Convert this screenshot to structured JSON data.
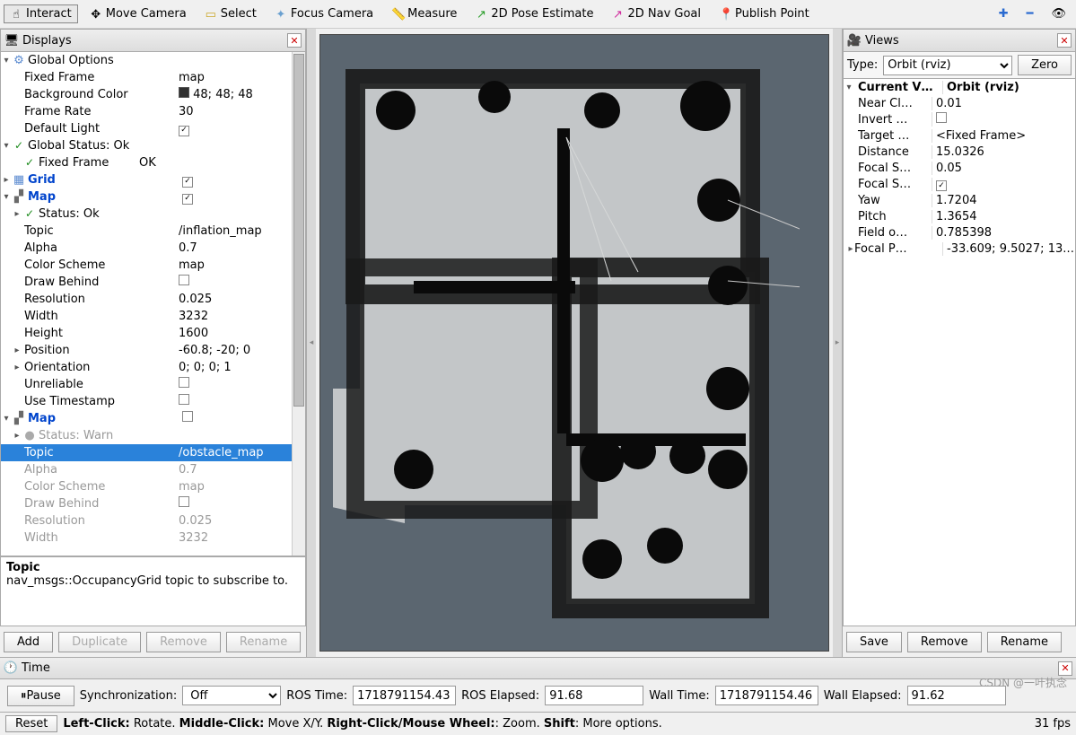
{
  "toolbar": {
    "interact": "Interact",
    "move_camera": "Move Camera",
    "select": "Select",
    "focus_camera": "Focus Camera",
    "measure": "Measure",
    "pose_2d": "2D Pose Estimate",
    "nav_2d": "2D Nav Goal",
    "publish_point": "Publish Point"
  },
  "displays": {
    "title": "Displays",
    "global_options": "Global Options",
    "fixed_frame_lbl": "Fixed Frame",
    "fixed_frame_val": "map",
    "bgcolor_lbl": "Background Color",
    "bgcolor_val": "48; 48; 48",
    "frame_rate_lbl": "Frame Rate",
    "frame_rate_val": "30",
    "default_light_lbl": "Default Light",
    "global_status": "Global Status: Ok",
    "fixed_frame2_lbl": "Fixed Frame",
    "fixed_frame2_val": "OK",
    "grid": "Grid",
    "map1": "Map",
    "status_ok": "Status: Ok",
    "topic_lbl": "Topic",
    "topic1_val": "/inflation_map",
    "alpha_lbl": "Alpha",
    "alpha_val": "0.7",
    "color_scheme_lbl": "Color Scheme",
    "color_scheme_val": "map",
    "draw_behind_lbl": "Draw Behind",
    "resolution_lbl": "Resolution",
    "resolution_val": "0.025",
    "width_lbl": "Width",
    "width_val": "3232",
    "height_lbl": "Height",
    "height_val": "1600",
    "position_lbl": "Position",
    "position_val": "-60.8; -20; 0",
    "orientation_lbl": "Orientation",
    "orientation_val": "0; 0; 0; 1",
    "unreliable_lbl": "Unreliable",
    "use_timestamp_lbl": "Use Timestamp",
    "map2": "Map",
    "status_warn": "Status: Warn",
    "topic2_val": "/obstacle_map",
    "alpha2_val": "0.7",
    "color_scheme2_val": "map",
    "resolution2_val": "0.025",
    "width2_val": "3232",
    "desc_title": "Topic",
    "desc_body": "nav_msgs::OccupancyGrid topic to subscribe to.",
    "add": "Add",
    "duplicate": "Duplicate",
    "remove": "Remove",
    "rename": "Rename"
  },
  "views": {
    "title": "Views",
    "type_lbl": "Type:",
    "type_val": "Orbit (rviz)",
    "zero": "Zero",
    "current_view": "Current V…",
    "current_view_val": "Orbit (rviz)",
    "near_clip": "Near Cl…",
    "near_clip_val": "0.01",
    "invert_z": "Invert …",
    "target": "Target …",
    "target_val": "<Fixed Frame>",
    "distance": "Distance",
    "distance_val": "15.0326",
    "focal_shape_size": "Focal S…",
    "focal_shape_size_val": "0.05",
    "focal_shape_fixed": "Focal S…",
    "yaw": "Yaw",
    "yaw_val": "1.7204",
    "pitch": "Pitch",
    "pitch_val": "1.3654",
    "fov": "Field o…",
    "fov_val": "0.785398",
    "focal_point": "Focal P…",
    "focal_point_val": "-33.609; 9.5027; 13.…",
    "save": "Save",
    "remove": "Remove",
    "rename": "Rename"
  },
  "time": {
    "title": "Time",
    "pause": "Pause",
    "sync_lbl": "Synchronization:",
    "sync_val": "Off",
    "ros_time_lbl": "ROS Time:",
    "ros_time_val": "1718791154.43",
    "ros_elapsed_lbl": "ROS Elapsed:",
    "ros_elapsed_val": "91.68",
    "wall_time_lbl": "Wall Time:",
    "wall_time_val": "1718791154.46",
    "wall_elapsed_lbl": "Wall Elapsed:",
    "wall_elapsed_val": "91.62"
  },
  "status": {
    "reset": "Reset",
    "hints_left": "Left-Click:",
    "hints_left_v": " Rotate. ",
    "hints_mid": "Middle-Click:",
    "hints_mid_v": " Move X/Y. ",
    "hints_right": "Right-Click/Mouse Wheel:",
    "hints_right_v": ": Zoom. ",
    "hints_shift": "Shift",
    "hints_shift_v": ": More options.",
    "fps": "31 fps"
  },
  "watermark": "CSDN @一叶执念"
}
